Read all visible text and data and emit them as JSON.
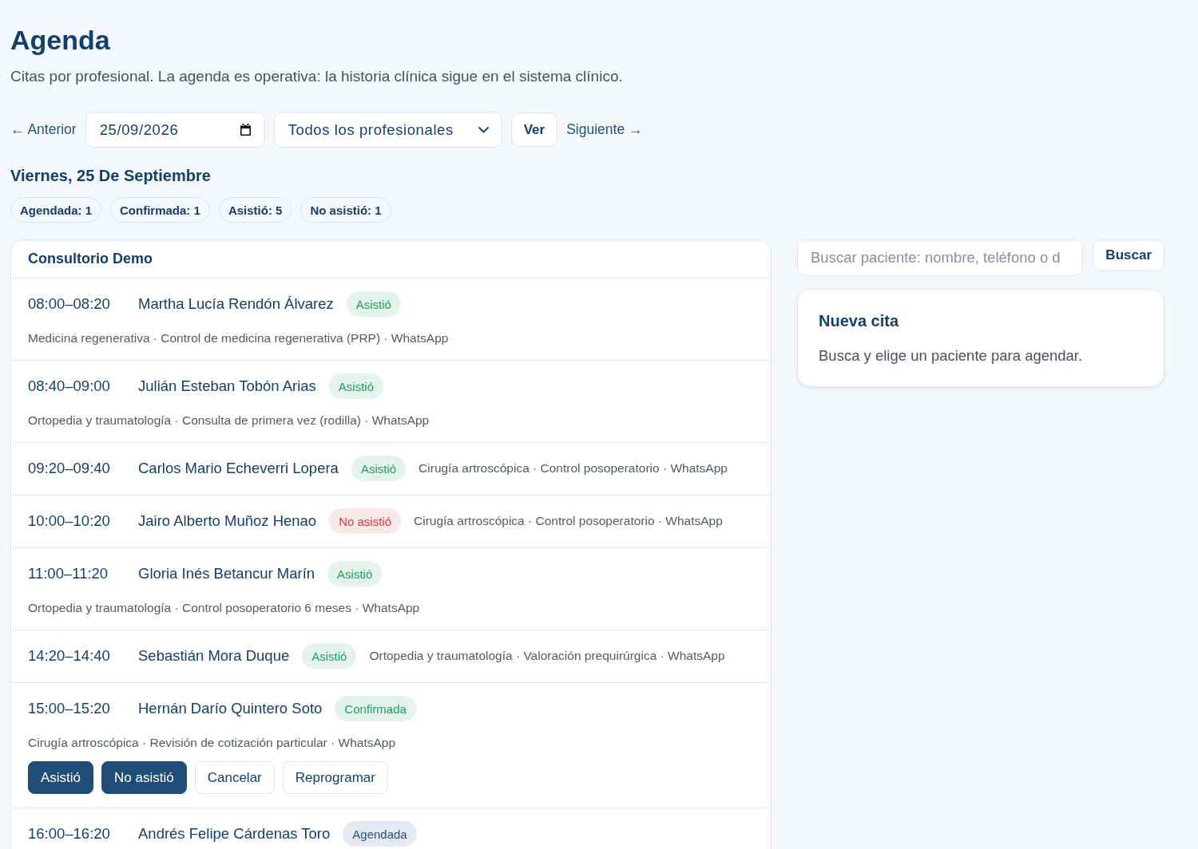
{
  "header": {
    "title": "Agenda",
    "subtitle": "Citas por profesional. La agenda es operativa: la historia clínica sigue en el sistema clínico."
  },
  "filters": {
    "previous": "← Anterior",
    "date": "25/09/2026",
    "professional": "Todos los profesionales",
    "view_button": "Ver",
    "next": "Siguiente →"
  },
  "day": {
    "title": "Viernes, 25 De Septiembre",
    "counts": [
      "Agendada: 1",
      "Confirmada: 1",
      "Asistió: 5",
      "No asistió: 1"
    ]
  },
  "schedule": {
    "office": "Consultorio Demo",
    "appointments": [
      {
        "time": "08:00–08:20",
        "patient": "Martha Lucía Rendón Álvarez",
        "status": {
          "label": "Asistió",
          "color": "#1f9d63"
        },
        "details": "Medicina regenerativa · Control de medicina regenerativa (PRP) · WhatsApp"
      },
      {
        "time": "08:40–09:00",
        "patient": "Julián Esteban Tobón Arias",
        "status": {
          "label": "Asistió",
          "color": "#1f9d63"
        },
        "details": "Ortopedia y traumatología · Consulta de primera vez (rodilla) · WhatsApp"
      },
      {
        "time": "09:20–09:40",
        "patient": "Carlos Mario Echeverri Lopera",
        "status": {
          "label": "Asistió",
          "color": "#1f9d63"
        },
        "details": "Cirugía artroscópica · Control posoperatorio · WhatsApp"
      },
      {
        "time": "10:00–10:20",
        "patient": "Jairo Alberto Muñoz Henao",
        "status": {
          "label": "No asistió",
          "color": "#d63b3b"
        },
        "details": "Cirugía artroscópica · Control posoperatorio · WhatsApp"
      },
      {
        "time": "11:00–11:20",
        "patient": "Gloria Inés Betancur Marín",
        "status": {
          "label": "Asistió",
          "color": "#1f9d63"
        },
        "details": "Ortopedia y traumatología · Control posoperatorio 6 meses · WhatsApp"
      },
      {
        "time": "14:20–14:40",
        "patient": "Sebastián Mora Duque",
        "status": {
          "label": "Asistió",
          "color": "#1f9d63"
        },
        "details": "Ortopedia y traumatología · Valoración prequirúrgica · WhatsApp"
      },
      {
        "time": "15:00–15:20",
        "patient": "Hernán Darío Quintero Soto",
        "status": {
          "label": "Confirmada",
          "color": "#1f9d63"
        },
        "details": "Cirugía artroscópica · Revisión de cotización particular · WhatsApp",
        "actions": [
          {
            "label": "Asistió",
            "kind": "primary"
          },
          {
            "label": "No asistió",
            "kind": "primary"
          },
          {
            "label": "Cancelar",
            "kind": "secondary"
          },
          {
            "label": "Reprogramar",
            "kind": "secondary"
          }
        ]
      },
      {
        "time": "16:00–16:20",
        "patient": "Andrés Felipe Cárdenas Toro",
        "status": {
          "label": "Agendada",
          "color": "#24527f"
        }
      }
    ]
  },
  "search": {
    "placeholder": "Buscar paciente: nombre, teléfono o d",
    "button": "Buscar"
  },
  "new_appointment": {
    "title": "Nueva cita",
    "message": "Busca y elige un paciente para agendar."
  }
}
